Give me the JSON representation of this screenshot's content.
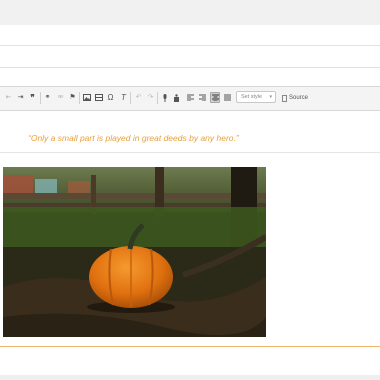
{
  "editor": {
    "quote": "“Only a small part is played in great deeds by any hero.”",
    "style_select": {
      "value": "Set style"
    },
    "source_label": "Source"
  },
  "toolbar_icons": [
    "outdent-icon",
    "indent-icon",
    "blockquote-icon",
    "link-icon",
    "unlink-icon",
    "anchor-icon",
    "image-icon",
    "horizontal-rule-icon",
    "special-char-icon",
    "remove-format-icon",
    "undo-icon",
    "redo-icon",
    "audio-icon",
    "table-icon",
    "align-left-icon",
    "align-right-icon",
    "align-center-icon",
    "align-justify-icon"
  ],
  "colors": {
    "accent": "#e8a03c",
    "toolbar_bg": "#f4f4f4"
  }
}
